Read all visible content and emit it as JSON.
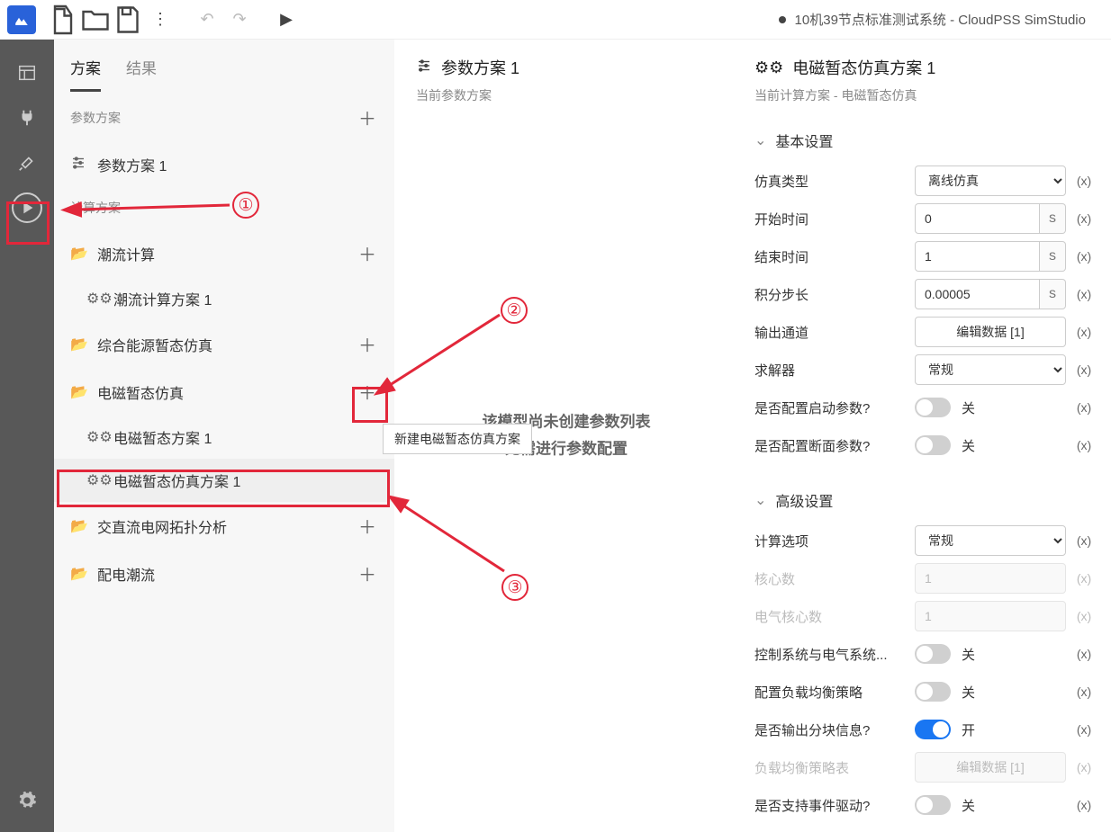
{
  "title": "10机39节点标准测试系统 - CloudPSS SimStudio",
  "tabs": {
    "t0": "方案",
    "t1": "结果"
  },
  "sections": {
    "param": "参数方案",
    "compute": "计算方案"
  },
  "tree": {
    "param1": "参数方案 1",
    "folder_flow": "潮流计算",
    "flow1": "潮流计算方案 1",
    "folder_energy": "综合能源暂态仿真",
    "folder_emt": "电磁暂态仿真",
    "emt0": "电磁暂态方案 1",
    "emt1": "电磁暂态仿真方案 1",
    "folder_acdc": "交直流电网拓扑分析",
    "folder_dist": "配电潮流"
  },
  "tooltip": "新建电磁暂态仿真方案",
  "mid": {
    "title": "参数方案 1",
    "sub": "当前参数方案",
    "empty1": "该模型尚未创建参数列表",
    "empty2": "无需进行参数配置"
  },
  "right": {
    "title": "电磁暂态仿真方案 1",
    "sub": "当前计算方案 - 电磁暂态仿真",
    "g_basic": "基本设置",
    "g_adv": "高级设置",
    "labels": {
      "sim_type": "仿真类型",
      "start": "开始时间",
      "end": "结束时间",
      "step": "积分步长",
      "output": "输出通道",
      "solver": "求解器",
      "startup": "是否配置启动参数?",
      "section": "是否配置断面参数?",
      "calc_opt": "计算选项",
      "cores": "核心数",
      "ecores": "电气核心数",
      "ctrl": "控制系统与电气系统...",
      "balance": "配置负载均衡策略",
      "block": "是否输出分块信息?",
      "table": "负载均衡策略表",
      "event": "是否支持事件驱动?"
    },
    "values": {
      "sim_type": "离线仿真",
      "start": "0",
      "end": "1",
      "step": "0.00005",
      "output": "编辑数据 [1]",
      "solver": "常规",
      "unit": "s",
      "calc_opt": "常规",
      "cores": "1",
      "ecores": "1",
      "table": "编辑数据 [1]",
      "on": "开",
      "off": "关",
      "x": "(x)"
    }
  },
  "annot": {
    "1": "①",
    "2": "②",
    "3": "③"
  }
}
